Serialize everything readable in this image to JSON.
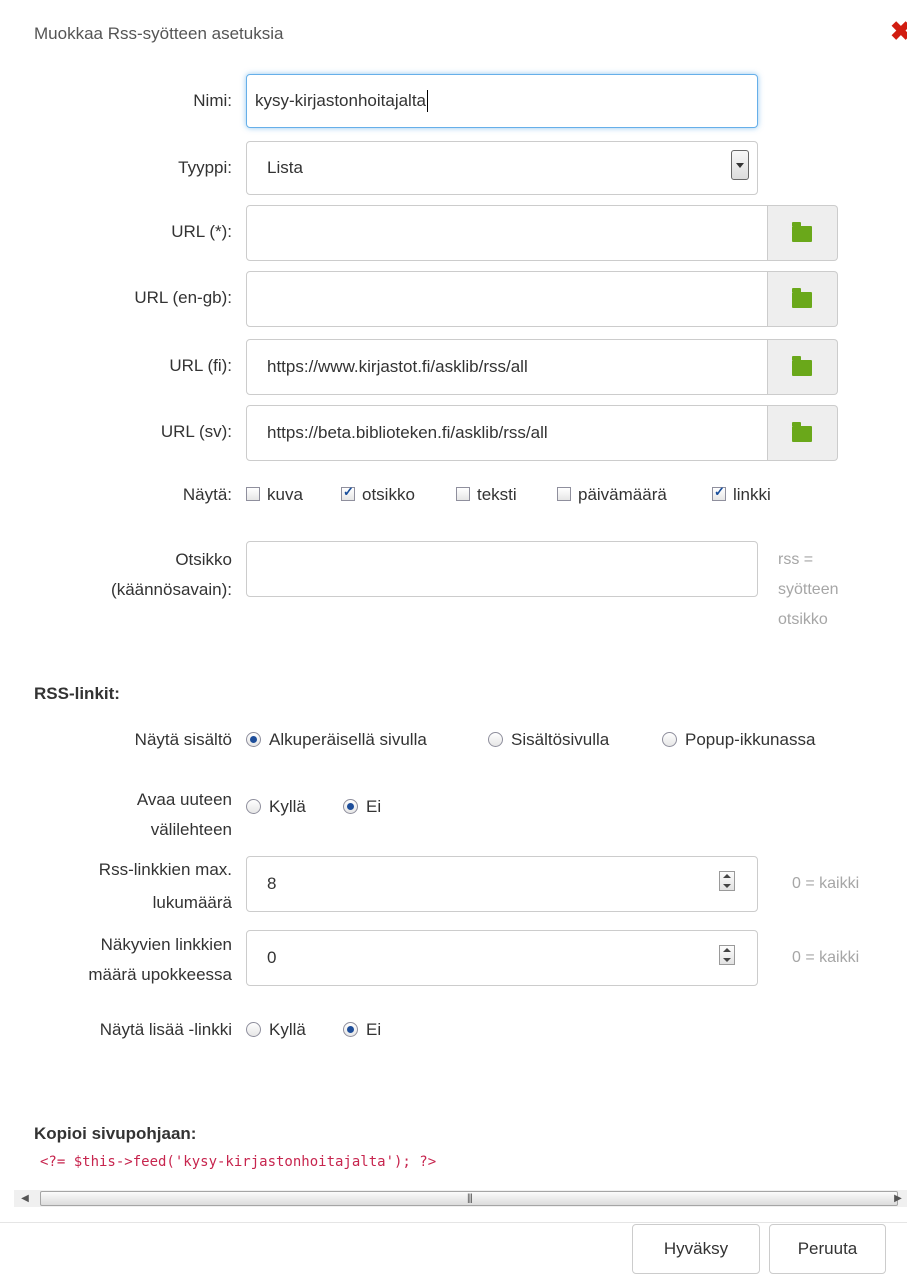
{
  "dialog": {
    "title": "Muokkaa Rss-syötteen asetuksia",
    "close_icon": "close-x-icon",
    "close_color": "#d11d11"
  },
  "form": {
    "name_label": "Nimi:",
    "name_value": "kysy-kirjastonhoitajalta",
    "type_label": "Tyyppi:",
    "type_value": "Lista",
    "url_default_label": "URL (*):",
    "url_default_value": "",
    "url_en_label": "URL (en-gb):",
    "url_en_value": "",
    "url_fi_label": "URL (fi):",
    "url_fi_value": "https://www.kirjastot.fi/asklib/rss/all",
    "url_sv_label": "URL (sv):",
    "url_sv_value": "https://beta.biblioteken.fi/asklib/rss/all",
    "folder_icon": "folder-icon",
    "show_label": "Näytä:",
    "show_options": [
      {
        "label": "kuva",
        "checked": false
      },
      {
        "label": "otsikko",
        "checked": true
      },
      {
        "label": "teksti",
        "checked": false
      },
      {
        "label": "päivämäärä",
        "checked": false
      },
      {
        "label": "linkki",
        "checked": true
      }
    ],
    "heading_label_line1": "Otsikko",
    "heading_label_line2": "(käännösavain):",
    "heading_value": "",
    "heading_hint_line1": "rss =",
    "heading_hint_line2": "syötteen",
    "heading_hint_line3": "otsikko"
  },
  "rss_links": {
    "section_title": "RSS-linkit:",
    "show_content_label": "Näytä sisältö",
    "show_content_options": [
      {
        "label": "Alkuperäisellä sivulla",
        "checked": true
      },
      {
        "label": "Sisältösivulla",
        "checked": false
      },
      {
        "label": "Popup-ikkunassa",
        "checked": false
      }
    ],
    "new_tab_label_line1": "Avaa uuteen",
    "new_tab_label_line2": "välilehteen",
    "new_tab_options": [
      {
        "label": "Kyllä",
        "checked": false
      },
      {
        "label": "Ei",
        "checked": true
      }
    ],
    "max_links_label_line1": "Rss-linkkien max.",
    "max_links_label_line2": "lukumäärä",
    "max_links_value": "8",
    "max_links_hint": "0 = kaikki",
    "visible_links_label_line1": "Näkyvien linkkien",
    "visible_links_label_line2": "määrä upokkeessa",
    "visible_links_value": "0",
    "visible_links_hint": "0 = kaikki",
    "show_more_label": "Näytä lisää -linkki",
    "show_more_options": [
      {
        "label": "Kyllä",
        "checked": false
      },
      {
        "label": "Ei",
        "checked": true
      }
    ]
  },
  "copy": {
    "section_title": "Kopioi sivupohjaan:",
    "code": "<?= $this->feed('kysy-kirjastonhoitajalta'); ?>",
    "code_color": "#c7254e"
  },
  "footer": {
    "accept_label": "Hyväksy",
    "cancel_label": "Peruuta"
  }
}
